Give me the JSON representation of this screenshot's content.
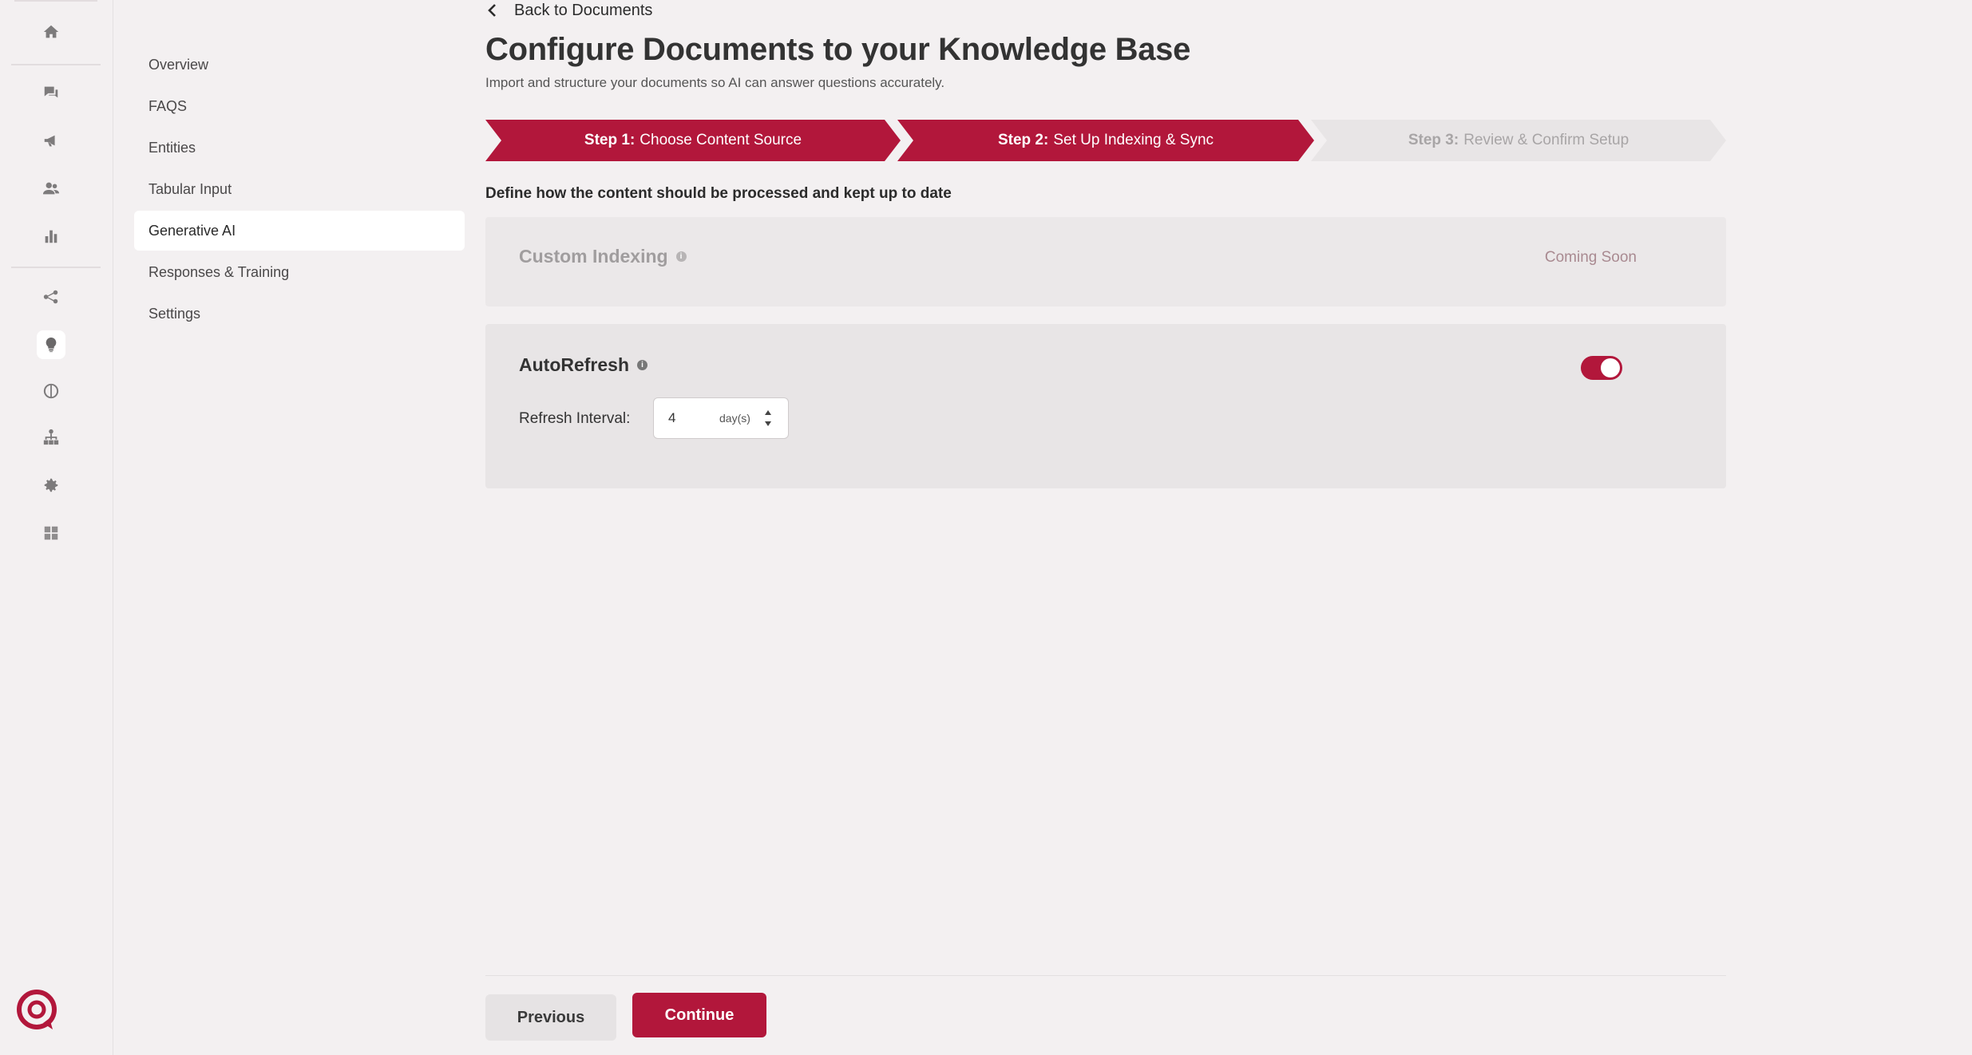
{
  "rail": {
    "icons": [
      "home-icon",
      "chat-icon",
      "megaphone-icon",
      "users-icon",
      "bar-chart-icon",
      "share-icon",
      "lightbulb-icon",
      "brain-icon",
      "hierarchy-icon",
      "gear-icon",
      "grid-image-icon"
    ],
    "active": "lightbulb-icon"
  },
  "subnav": {
    "items": [
      "Overview",
      "FAQS",
      "Entities",
      "Tabular Input",
      "Generative AI",
      "Responses & Training",
      "Settings"
    ],
    "active": "Generative AI"
  },
  "header": {
    "back_label": "Back to Documents",
    "title": "Configure Documents to your Knowledge Base",
    "subtitle": "Import and structure your documents so AI can answer questions accurately."
  },
  "stepper": {
    "steps": [
      {
        "prefix": "Step 1:",
        "label": "Choose Content Source",
        "state": "complete"
      },
      {
        "prefix": "Step 2:",
        "label": "Set Up Indexing & Sync",
        "state": "current"
      },
      {
        "prefix": "Step 3:",
        "label": "Review & Confirm Setup",
        "state": "pending"
      }
    ]
  },
  "section": {
    "label": "Define how the content should be processed and kept up to date"
  },
  "custom_indexing": {
    "title": "Custom Indexing",
    "status": "Coming Soon"
  },
  "autorefresh": {
    "title": "AutoRefresh",
    "enabled": true,
    "interval_label": "Refresh Interval:",
    "interval_value": "4",
    "interval_unit": "day(s)"
  },
  "footer": {
    "previous_label": "Previous",
    "continue_label": "Continue"
  },
  "colors": {
    "accent": "#b2173b",
    "background": "#f3f0f1",
    "card": "#e8e5e6"
  }
}
